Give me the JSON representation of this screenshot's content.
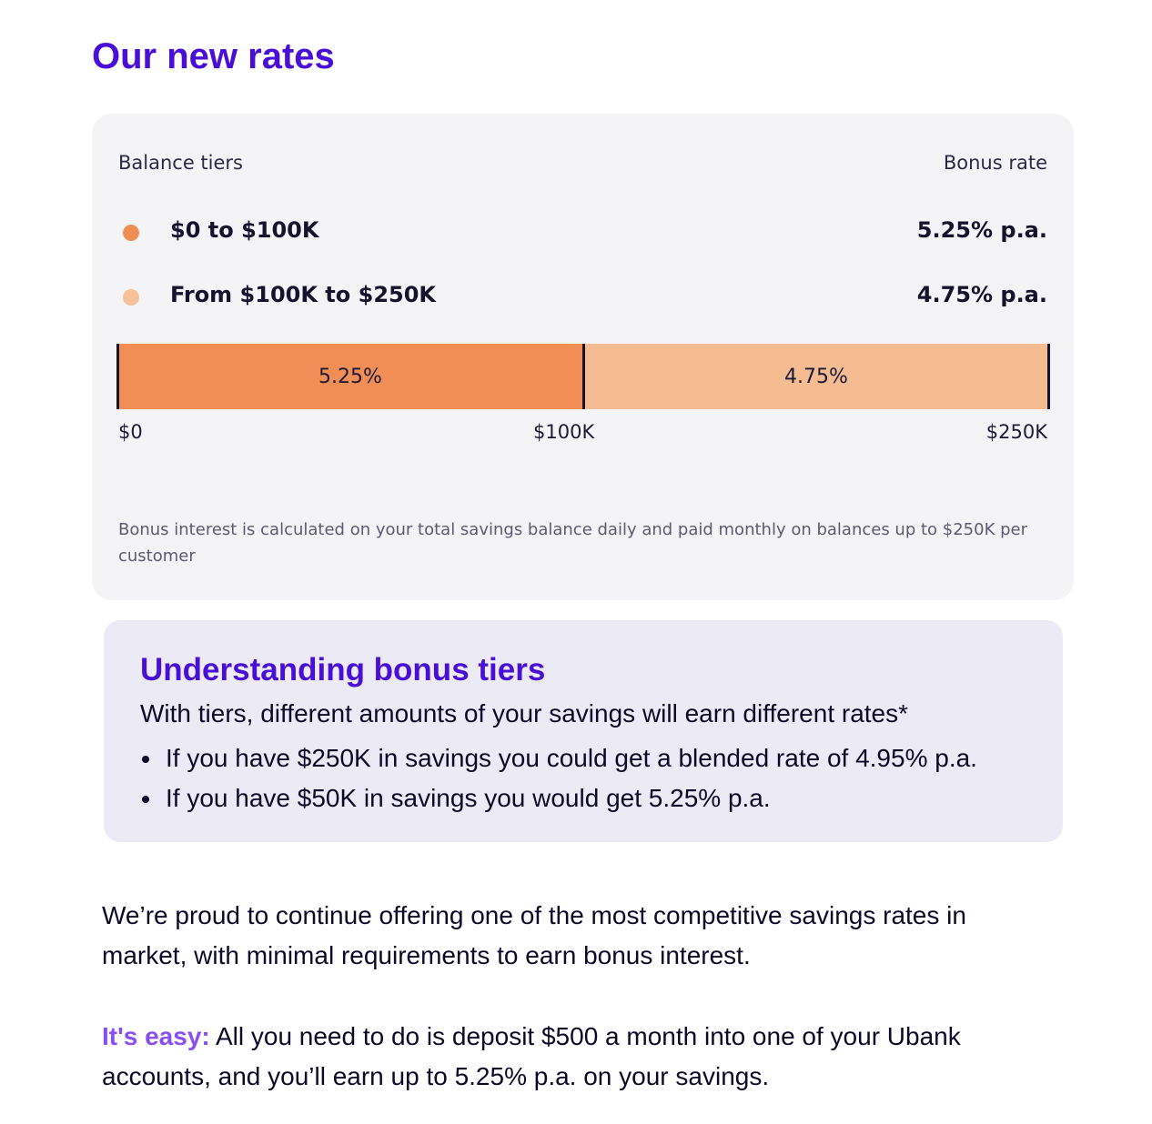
{
  "title": "Our new rates",
  "rates_card": {
    "header_left": "Balance tiers",
    "header_right": "Bonus rate",
    "tiers": [
      {
        "label": "$0 to $100K",
        "rate": "5.25% p.a.",
        "color": "#f08e55"
      },
      {
        "label": "From $100K to $250K",
        "rate": "4.75% p.a.",
        "color": "#f7c096"
      }
    ],
    "bar": {
      "segments": [
        {
          "label": "5.25%",
          "from": 0,
          "to": 100000,
          "color": "#f08e55"
        },
        {
          "label": "4.75%",
          "from": 100000,
          "to": 250000,
          "color": "#f5bc92"
        }
      ],
      "axis_labels": [
        "$0",
        "$100K",
        "$250K"
      ]
    },
    "footnote": "Bonus interest is calculated on your total savings balance daily and paid monthly on balances up to $250K per customer"
  },
  "understanding": {
    "title": "Understanding bonus tiers",
    "intro": "With tiers, different amounts of your savings will earn different rates*",
    "bullets": [
      "If you have $250K in savings you could get a blended rate of 4.95% p.a.",
      "If you have $50K in savings you would get 5.25% p.a."
    ]
  },
  "paragraph_1": "We’re proud to continue offering one of the most competitive savings rates in market, with minimal requirements to earn bonus interest.",
  "paragraph_2": {
    "lead": "It's easy:",
    "text": " All you need to do is deposit $500 a month into one of your Ubank accounts, and you’ll earn up to 5.25% p.a. on your savings."
  },
  "colors": {
    "heading": "#4a0fd6",
    "accent_lead": "#8a4ef0",
    "card_bg": "#f4f4f7",
    "box_bg": "#eceaf4"
  }
}
